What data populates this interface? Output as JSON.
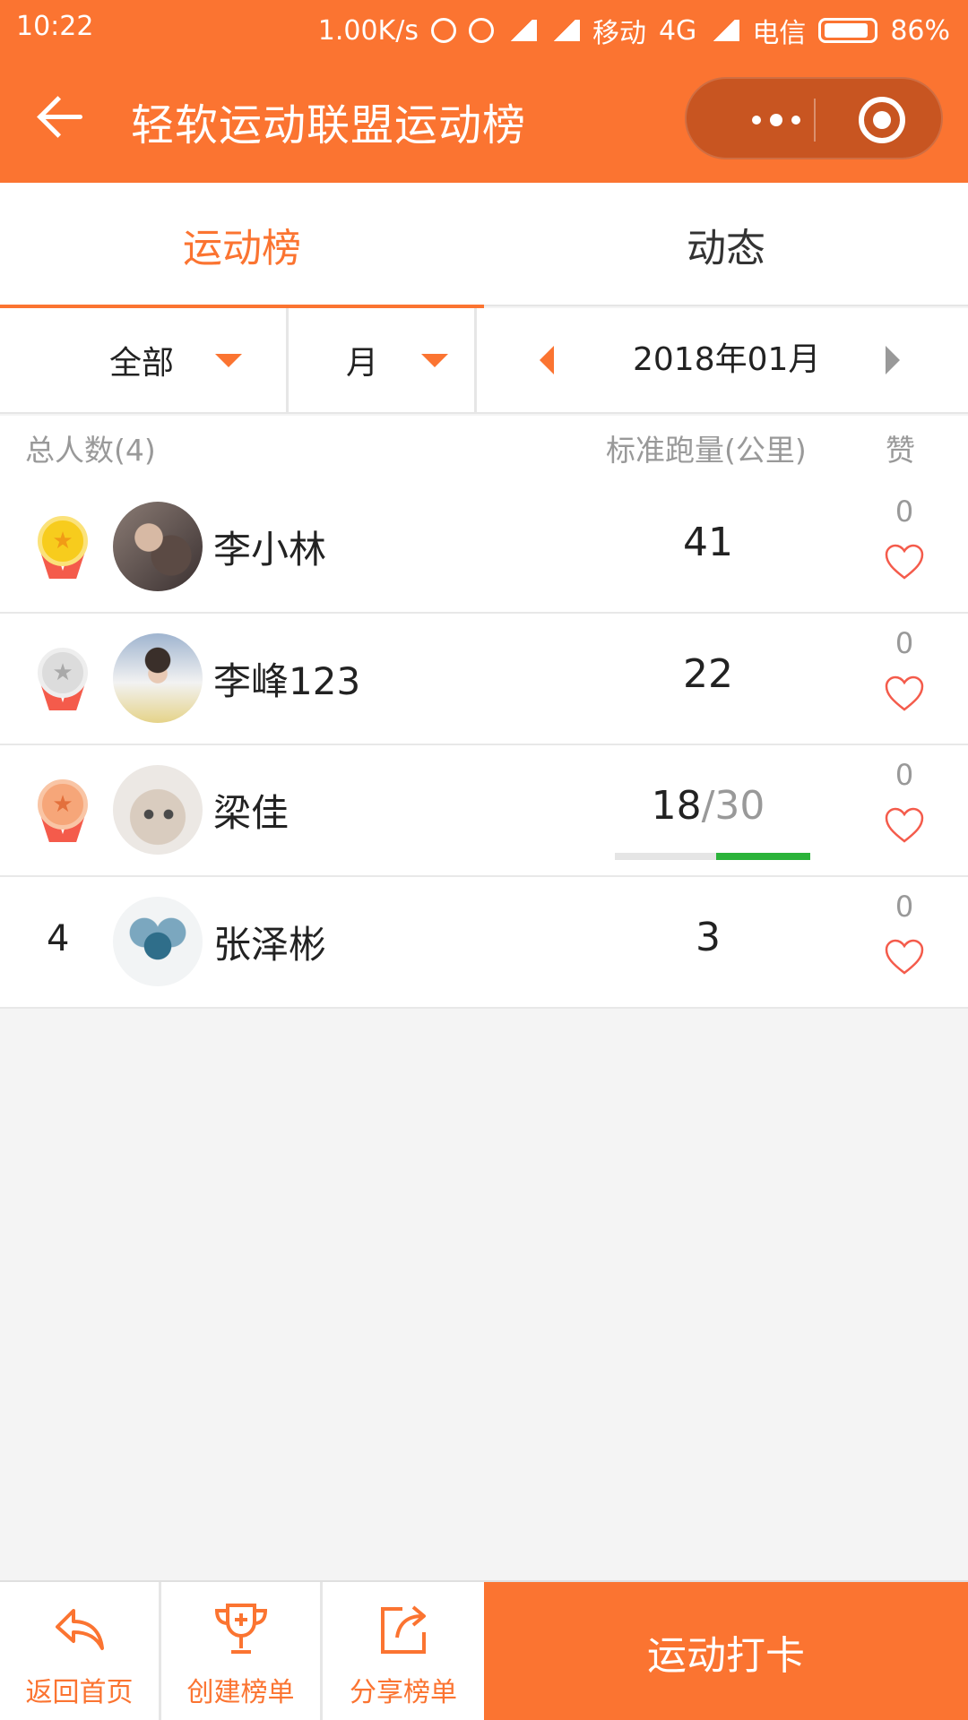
{
  "status_bar": {
    "time": "10:22",
    "network_speed": "1.00K/s",
    "carrier1": "移动",
    "network_type": "4G",
    "carrier2": "电信",
    "battery": "86%"
  },
  "header": {
    "title": "轻软运动联盟运动榜"
  },
  "tabs": [
    {
      "label": "运动榜",
      "active": true
    },
    {
      "label": "动态",
      "active": false
    }
  ],
  "filters": {
    "scope": "全部",
    "period": "月",
    "date": "2018年01月"
  },
  "list_header": {
    "total": "总人数(4)",
    "distance": "标准跑量(公里)",
    "likes": "赞"
  },
  "rows": [
    {
      "rank": "1",
      "medal": "gold",
      "name": "李小林",
      "distance": "41",
      "likes": "0"
    },
    {
      "rank": "2",
      "medal": "silver",
      "name": "李峰123",
      "distance": "22",
      "likes": "0"
    },
    {
      "rank": "3",
      "medal": "bronze",
      "name": "梁佳",
      "distance": "18",
      "target": "/30",
      "progress": 0.6,
      "likes": "0"
    },
    {
      "rank": "4",
      "medal": "",
      "name": "张泽彬",
      "distance": "3",
      "likes": "0"
    }
  ],
  "bottom_bar": {
    "home": "返回首页",
    "create": "创建榜单",
    "share": "分享榜单",
    "checkin": "运动打卡"
  },
  "colors": {
    "accent": "#fb7431",
    "progress": "#2bb33a",
    "heart": "#f45b4b"
  }
}
